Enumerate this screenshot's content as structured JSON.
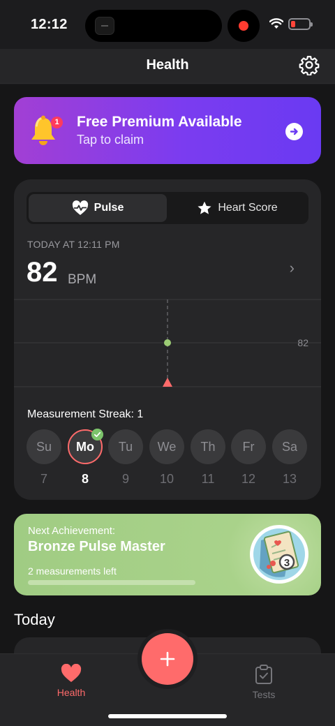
{
  "status_bar": {
    "time": "12:12"
  },
  "nav": {
    "title": "Health",
    "settings_icon": "gear-icon"
  },
  "premium": {
    "badge": "1",
    "title": "Free Premium Available",
    "subtitle": "Tap to claim"
  },
  "pulse_card": {
    "segments": [
      {
        "label": "Pulse",
        "icon": "heart-pulse-icon",
        "selected": true
      },
      {
        "label": "Heart Score",
        "icon": "star-icon",
        "selected": false
      }
    ],
    "timestamp": "TODAY AT 12:11 PM",
    "value": "82",
    "unit": "BPM",
    "chart_marker_label": "82",
    "streak_label": "Measurement Streak: 1",
    "days": [
      {
        "short": "Su",
        "date": "7"
      },
      {
        "short": "Mo",
        "date": "8",
        "active": true,
        "checked": true
      },
      {
        "short": "Tu",
        "date": "9"
      },
      {
        "short": "We",
        "date": "10"
      },
      {
        "short": "Th",
        "date": "11"
      },
      {
        "short": "Fr",
        "date": "12"
      },
      {
        "short": "Sa",
        "date": "13"
      }
    ]
  },
  "achievement": {
    "title": "Next Achievement:",
    "name": "Bronze Pulse Master",
    "remaining": "2 measurements left",
    "badge_number": "3"
  },
  "today": {
    "heading": "Today"
  },
  "tabbar": {
    "health": "Health",
    "tests": "Tests"
  },
  "colors": {
    "accent": "#ff6b6b",
    "premium_start": "#a23fd4",
    "premium_end": "#6a3af2",
    "achievement": "#a9d28a",
    "chart_point": "#9ccc75"
  }
}
